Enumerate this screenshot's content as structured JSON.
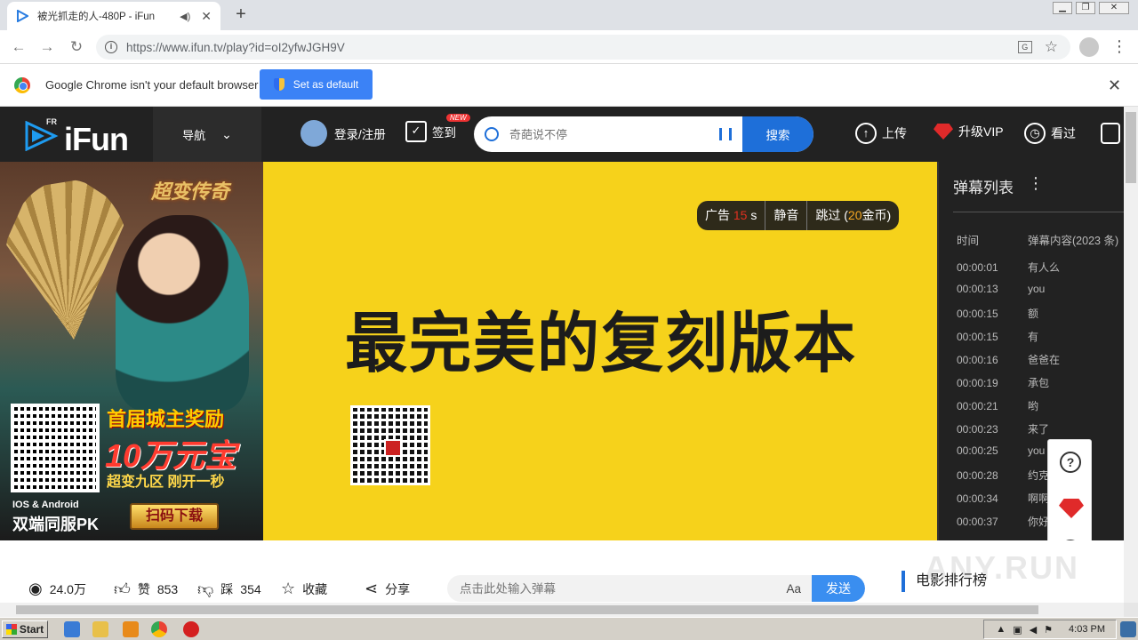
{
  "browser": {
    "tab_title": "被光抓走的人-480P - iFun",
    "url": "https://www.ifun.tv/play?id=oI2yfwJGH9V",
    "infobar_text": "Google Chrome isn't your default browser",
    "set_default_label": "Set as default"
  },
  "site": {
    "brand": "iFun",
    "brand_sup": "FR",
    "nav_label": "导航",
    "login_label": "登录/注册",
    "signin_label": "签到",
    "new_badge": "NEW",
    "search_placeholder": "奇葩说不停",
    "search_button": "搜索",
    "upload_label": "上传",
    "vip_label": "升级VIP",
    "history_label": "看过"
  },
  "left_ad": {
    "game_logo": "超变传奇",
    "promo_line1": "首届城主奖励",
    "promo_line2": "10万元宝",
    "promo_line3": "超变九区 刚开一秒",
    "platform": "IOS & Android",
    "pk_text": "双端同服PK",
    "scan_button": "扫码下载"
  },
  "video_ad": {
    "ad_label": "广告",
    "countdown": "15",
    "countdown_unit": "s",
    "mute_label": "静音",
    "skip_prefix": "跳过 (",
    "skip_cost": "20",
    "skip_suffix": "金币)",
    "headline": "最完美的复刻版本"
  },
  "danmaku": {
    "title": "弹幕列表",
    "col_time": "时间",
    "col_content": "弹幕内容(2023 条)",
    "rows": [
      {
        "time": "00:00:01",
        "text": "有人么"
      },
      {
        "time": "00:00:13",
        "text": "you"
      },
      {
        "time": "00:00:15",
        "text": "额"
      },
      {
        "time": "00:00:15",
        "text": "有"
      },
      {
        "time": "00:00:16",
        "text": "爸爸在"
      },
      {
        "time": "00:00:19",
        "text": "承包"
      },
      {
        "time": "00:00:21",
        "text": "哟"
      },
      {
        "time": "00:00:23",
        "text": "来了"
      },
      {
        "time": "00:00:25",
        "text": "you"
      },
      {
        "time": "00:00:28",
        "text": "约克"
      },
      {
        "time": "00:00:34",
        "text": "啊啊"
      },
      {
        "time": "00:00:37",
        "text": "你好"
      }
    ]
  },
  "bottom": {
    "views": "24.0万",
    "likes_label": "赞",
    "likes": "853",
    "dislikes_label": "踩",
    "dislikes": "354",
    "favorite_label": "收藏",
    "share_label": "分享",
    "danmaku_placeholder": "点击此处输入弹幕",
    "font_toggle": "Aa",
    "send_label": "发送",
    "rank_label": "电影排行榜",
    "watermark": "ANY.RUN"
  },
  "taskbar": {
    "start_label": "Start",
    "clock": "4:03 PM"
  },
  "colors": {
    "header_bg": "#222222",
    "accent_blue": "#1e6fd9",
    "video_bg": "#f6d21b",
    "vip_red": "#e02a2a"
  }
}
